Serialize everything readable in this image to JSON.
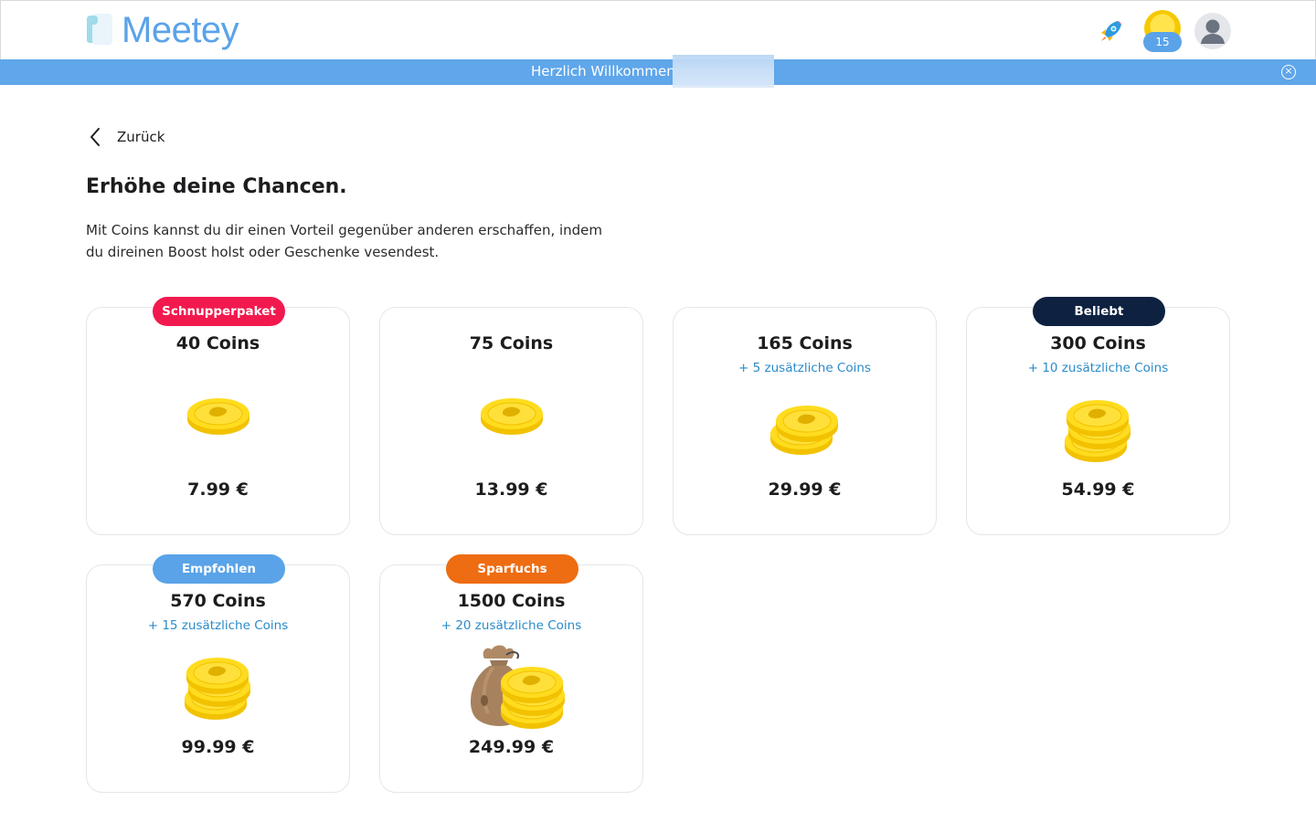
{
  "app": {
    "name": "Meetey"
  },
  "header": {
    "coin_count": "15",
    "icons": [
      "rocket-icon",
      "coin-icon",
      "user-avatar-icon"
    ]
  },
  "banner": {
    "text": "Herzlich Willkommen",
    "close_icon": "close-circle-icon"
  },
  "nav": {
    "back_label": "Zurück"
  },
  "page": {
    "title": "Erhöhe deine Chancen.",
    "description": "Mit Coins kannst du dir einen Vorteil gegenüber anderen erschaffen, indem du direinen Boost holst oder Geschenke vesendest."
  },
  "colors": {
    "brand": "#5aa3e8",
    "banner": "#5fa6ea",
    "bonus_text": "#2a8bc8"
  },
  "packages": [
    {
      "badge": "Schnupperpaket",
      "badge_color": "#f2194e",
      "coins": "40 Coins",
      "bonus": "",
      "price": "7.99 €",
      "art": "single-coin"
    },
    {
      "badge": "",
      "badge_color": "",
      "coins": "75 Coins",
      "bonus": "",
      "price": "13.99 €",
      "art": "single-coin"
    },
    {
      "badge": "",
      "badge_color": "",
      "coins": "165 Coins",
      "bonus": "+ 5 zusätzliche Coins",
      "price": "29.99 €",
      "art": "double-coin"
    },
    {
      "badge": "Beliebt",
      "badge_color": "#0e2140",
      "coins": "300 Coins",
      "bonus": "+ 10 zusätzliche Coins",
      "price": "54.99 €",
      "art": "triple-coin"
    },
    {
      "badge": "Empfohlen",
      "badge_color": "#5aa3e8",
      "coins": "570 Coins",
      "bonus": "+ 15 zusätzliche Coins",
      "price": "99.99 €",
      "art": "triple-coin"
    },
    {
      "badge": "Sparfuchs",
      "badge_color": "#ee6c12",
      "coins": "1500 Coins",
      "bonus": "+ 20 zusätzliche Coins",
      "price": "249.99 €",
      "art": "money-bag"
    }
  ]
}
